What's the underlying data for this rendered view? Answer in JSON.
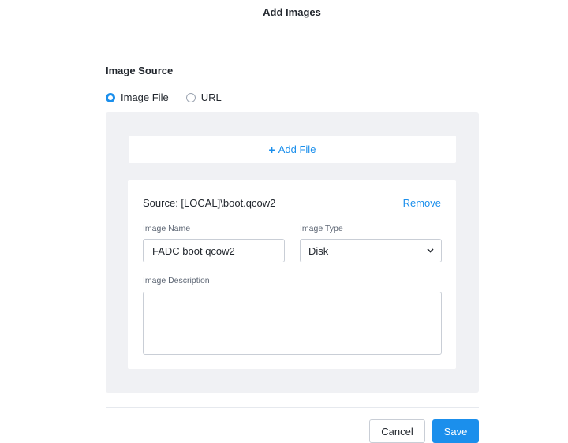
{
  "dialog": {
    "title": "Add Images"
  },
  "image_source": {
    "label": "Image Source",
    "options": [
      {
        "label": "Image File",
        "selected": true
      },
      {
        "label": "URL",
        "selected": false
      }
    ]
  },
  "upload": {
    "add_file_label": "Add File",
    "plus_glyph": "+"
  },
  "file": {
    "source": "Source: [LOCAL]\\boot.qcow2",
    "remove_label": "Remove",
    "name_label": "Image Name",
    "name_value": "FADC boot qcow2",
    "type_label": "Image Type",
    "type_value": "Disk",
    "description_label": "Image Description",
    "description_value": ""
  },
  "footer": {
    "cancel_label": "Cancel",
    "save_label": "Save"
  },
  "colors": {
    "accent": "#1b8fec",
    "panel": "#f0f1f4",
    "border": "#c9ced6"
  },
  "icons": {
    "dropdown": "chevron-down-icon"
  }
}
